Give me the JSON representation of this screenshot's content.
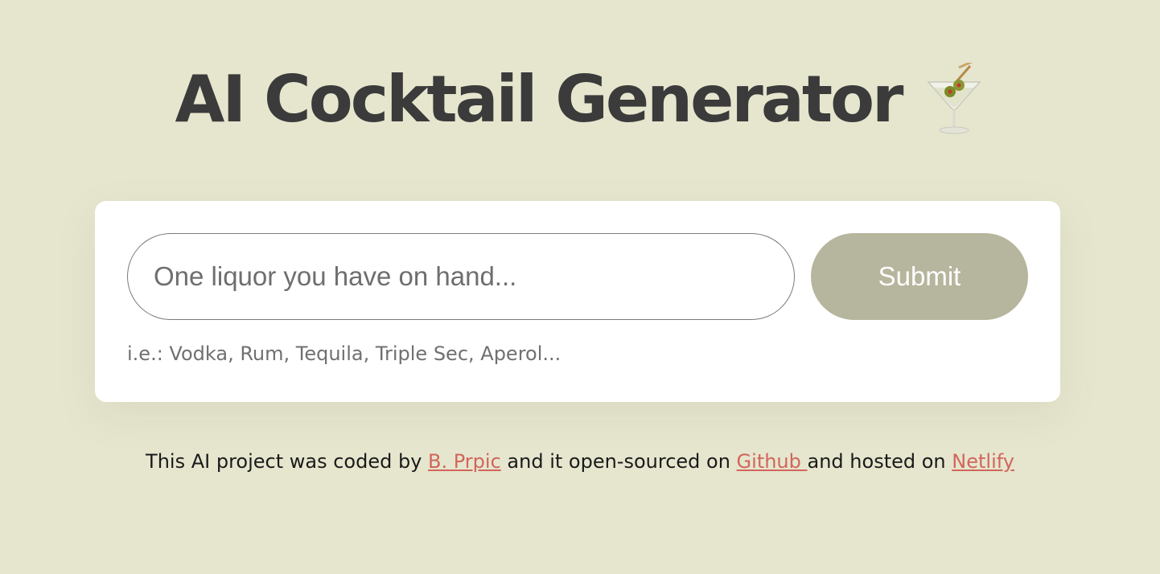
{
  "header": {
    "title": "AI Cocktail Generator",
    "icon": "martini-glass-icon"
  },
  "form": {
    "input_placeholder": "One liquor you have on hand...",
    "input_value": "",
    "submit_label": "Submit",
    "hint": "i.e.: Vodka, Rum, Tequila, Triple Sec, Aperol..."
  },
  "footer": {
    "text_1": "This AI project was coded by ",
    "author_link": "B. Prpic",
    "text_2": " and it open-sourced on ",
    "github_link": "Github ",
    "text_3": "and hosted on ",
    "netlify_link": "Netlify"
  },
  "colors": {
    "background": "#e6e6cf",
    "card": "#ffffff",
    "button": "#b6b59d",
    "link": "#d2665a",
    "title": "#3b3b3b"
  }
}
